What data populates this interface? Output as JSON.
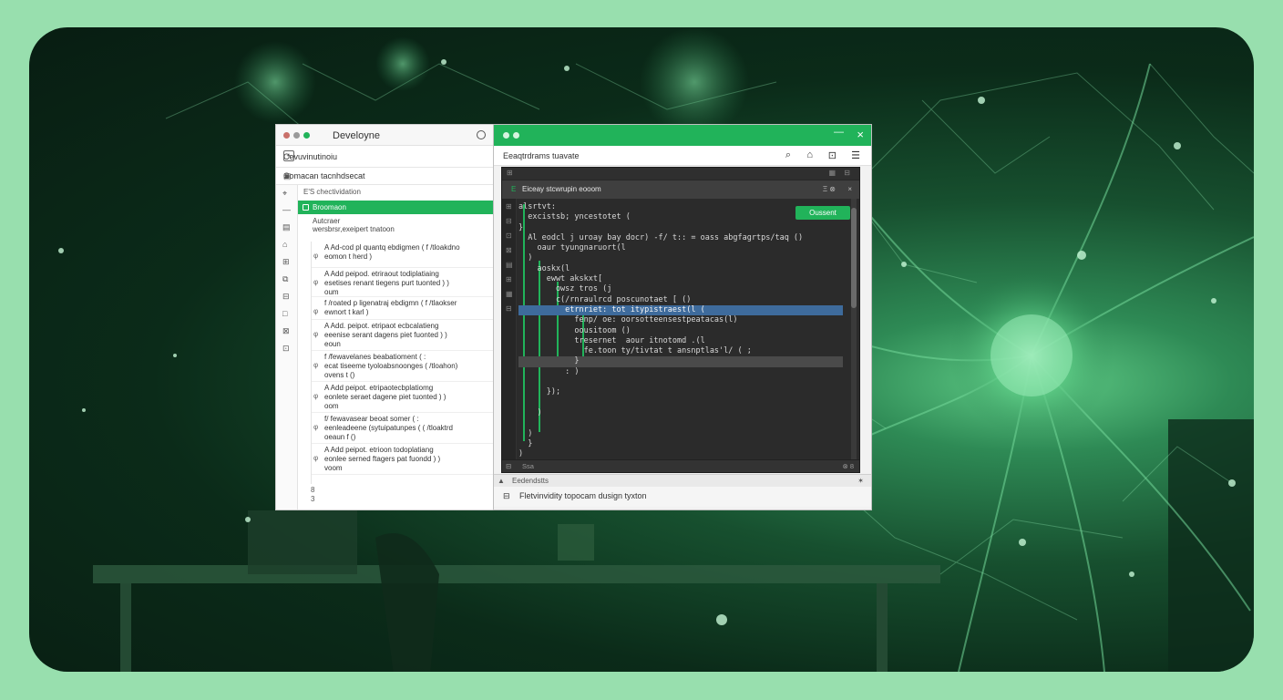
{
  "left_window": {
    "title": "Develoyne",
    "subtitle": "Cevuvinutinoiu",
    "toolbar_label": "Comacan tacnhdsecat",
    "breadcrumb": "E'S chectividation",
    "selected_item": "Broomaon",
    "header_line1": "Autcraer",
    "header_line2": "wersbrsr,exeipert tnatoon",
    "items": [
      {
        "l1": "A Ad-cod pl quantq ebdigmen ( f /tloakdno",
        "l2": "eomon t herd )"
      },
      {
        "l1": "A Add peipod. etriraout todiplatiaing",
        "l2": "esetises renant tiegens purt tuonted ) )",
        "l3": "oum"
      },
      {
        "l1": "f /roated p ligenatraj ebdigmn ( f /tlaokser",
        "l2": "ewnort t karl )"
      },
      {
        "l1": "A Add. peipot. etripaot ecbcalatieng",
        "l2": "eeenise serant dagens piet fuonted ) )",
        "l3": "eoun"
      },
      {
        "l1": "f /fewavelanes beabatioment ( :",
        "l2": "ecat tiseeme tyoloabsnoonges ( /tloahon)",
        "l3": "ovens t ()"
      },
      {
        "l1": "A Add peipot. etripaotecbplatiomg",
        "l2": "eonlete seraet dagene piet tuonted ) )",
        "l3": "oom"
      },
      {
        "l1": "f/ fewavasear beoat somer ( :",
        "l2": "eenleadeene (sytuipatunpes ( ( /tloaktrd",
        "l3": "oeaun f ()"
      },
      {
        "l1": "A Add peipot. etrioon todoplatiang",
        "l2": "eonlee serned ftagers pat fuondd ) )",
        "l3": "voom"
      }
    ],
    "footer_line1": "8",
    "footer_line2": "3"
  },
  "right_window": {
    "minimize_icon": "—",
    "close_icon": "×",
    "toolbar_title": "Eeaqtrdrams tuavate",
    "editor_top_left": "⊞",
    "editor_tab_title": "Eiceay stcwrupin eooom",
    "editor_tab_right": "Ξ ⊗",
    "run_button": "Oussent",
    "code_lines": [
      "alsrtvt:",
      "  excistsb; yncestotet (",
      "}",
      "  Al eodcl j uroay bay docr) -f/ t:: = oass abgfagrtps/taq ()",
      "    oaur tyungnaruort(l",
      "  )",
      "    aoskx(l",
      "      ewwt akskxt[",
      "        owsz tros (j",
      "        c(/rnraulrcd poscunotaet [ ()",
      "          etrnriet: tot itypistraest(l (",
      "            fenp/ oe: oorsotteensestpeatacas(l)",
      "            oousitoom ()",
      "            tresernet  aour itnotomd .(l",
      "              fe.toon ty/tivtat t ansnptlas'l/ ( ;",
      "            }",
      "          : )",
      "",
      "      });",
      "",
      "    )",
      "",
      "  )",
      "  }",
      ")"
    ],
    "editor_footer_left": "Ssa",
    "editor_footer_right": "⊗ 8",
    "bottom_bar_label": "Eedendstts",
    "bottom_bar_right": "✶",
    "status_text": "Fletvinvidity topocam  dusign tyxton"
  },
  "colors": {
    "accent": "#21b35a",
    "editor_bg": "#2b2b2b",
    "highlight": "#3e6b9c"
  }
}
